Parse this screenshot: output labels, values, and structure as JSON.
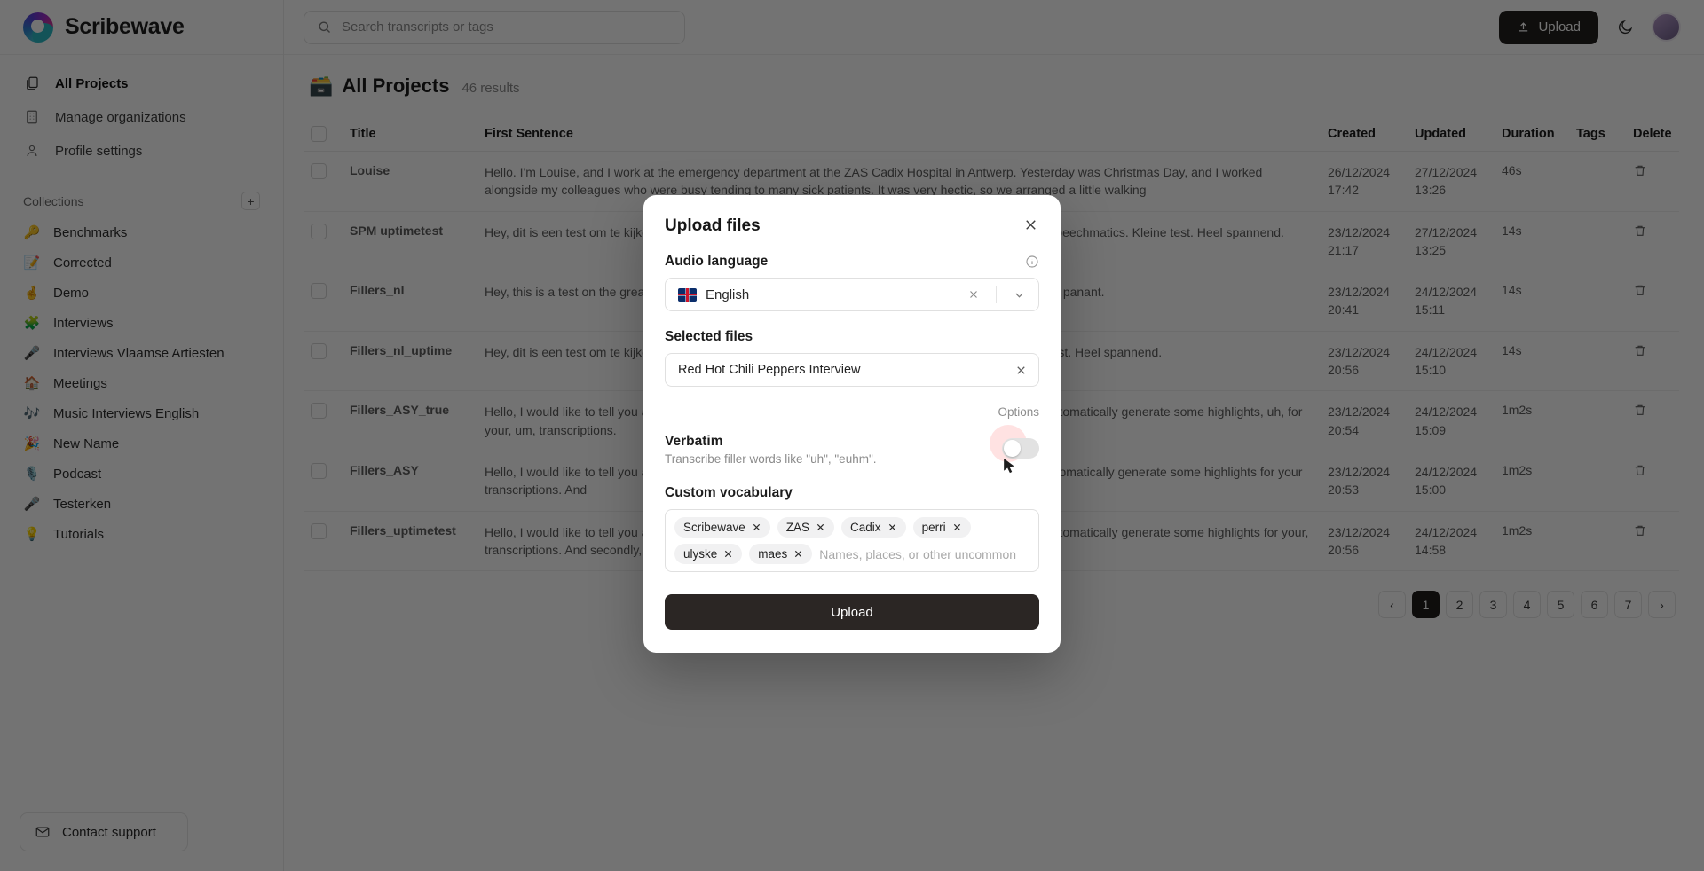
{
  "sidebar": {
    "brand": "Scribewave",
    "nav": [
      {
        "label": "All Projects",
        "icon": "documents-icon"
      },
      {
        "label": "Manage organizations",
        "icon": "building-icon"
      },
      {
        "label": "Profile settings",
        "icon": "user-icon"
      }
    ],
    "collections_title": "Collections",
    "add_label": "+",
    "collections": [
      {
        "emoji": "🔑",
        "label": "Benchmarks"
      },
      {
        "emoji": "📝",
        "label": "Corrected"
      },
      {
        "emoji": "🤞",
        "label": "Demo"
      },
      {
        "emoji": "🧩",
        "label": "Interviews"
      },
      {
        "emoji": "🎤",
        "label": "Interviews Vlaamse Artiesten"
      },
      {
        "emoji": "🏠",
        "label": "Meetings"
      },
      {
        "emoji": "🎶",
        "label": "Music Interviews English"
      },
      {
        "emoji": "🎉",
        "label": "New Name"
      },
      {
        "emoji": "🎙️",
        "label": "Podcast"
      },
      {
        "emoji": "🎤",
        "label": "Testerken"
      },
      {
        "emoji": "💡",
        "label": "Tutorials"
      }
    ],
    "support_label": "Contact support"
  },
  "topbar": {
    "search_placeholder": "Search transcripts or tags",
    "upload_label": "Upload",
    "theme_icon": "moon-icon"
  },
  "page": {
    "title": "All Projects",
    "title_emoji": "🗃️",
    "results": "46 results"
  },
  "table": {
    "columns": [
      "Title",
      "First Sentence",
      "Created",
      "Updated",
      "Duration",
      "Tags",
      "Delete"
    ],
    "rows": [
      {
        "title": "Louise",
        "sentence": "Hello. I'm Louise, and I work at the emergency department at the ZAS Cadix Hospital in Antwerp. Yesterday was Christmas Day, and I worked alongside my colleagues who were busy tending to many sick patients. It was very hectic, so we arranged a little walking",
        "created_date": "26/12/2024",
        "created_time": "17:42",
        "updated_date": "27/12/2024",
        "updated_time": "13:26",
        "duration": "46s"
      },
      {
        "title": "SPM uptimetest",
        "sentence": "Hey, dit is een test om te kijken of onze uptime goed is en of alles correct getranscribeerd worden met Speechmatics. Kleine test. Heel spannend.",
        "created_date": "23/12/2024",
        "created_time": "21:17",
        "updated_date": "27/12/2024",
        "updated_time": "13:25",
        "duration": "14s"
      },
      {
        "title": "Fillers_nl",
        "sentence": "Hey, this is a test on the great platform of Scribewave to see what were the speechmatics clementist hills panant.",
        "created_date": "23/12/2024",
        "created_time": "20:41",
        "updated_date": "24/12/2024",
        "updated_time": "15:11",
        "duration": "14s"
      },
      {
        "title": "Fillers_nl_uptime",
        "sentence": "Hey, dit is een test om te kijken of alles correct getranscribeerd worden met Speechmatics! Een kleine test. Heel spannend.",
        "created_date": "23/12/2024",
        "created_time": "20:56",
        "updated_date": "24/12/2024",
        "updated_time": "15:10",
        "duration": "14s"
      },
      {
        "title": "Fillers_ASY_true",
        "sentence": "Hello, I would like to tell you about Scribewave, which is a very nice, tool which allows you to highlight automatically generate some highlights, uh, for your, um, transcriptions.",
        "created_date": "23/12/2024",
        "created_time": "20:54",
        "updated_date": "24/12/2024",
        "updated_time": "15:09",
        "duration": "1m2s"
      },
      {
        "title": "Fillers_ASY",
        "sentence": "Hello, I would like to tell you about Scribewave, which is a very nice tool which allows you to highlight automatically generate some highlights for your transcriptions. And",
        "created_date": "23/12/2024",
        "created_time": "20:53",
        "updated_date": "24/12/2024",
        "updated_time": "15:00",
        "duration": "1m2s"
      },
      {
        "title": "Fillers_uptimetest",
        "sentence": "Hello, I would like to tell you about Scribewave, which is a very nice, tool which allows you to highlight automatically generate some highlights for your, transcriptions. And secondly, the",
        "created_date": "23/12/2024",
        "created_time": "20:56",
        "updated_date": "24/12/2024",
        "updated_time": "14:58",
        "duration": "1m2s"
      }
    ]
  },
  "pagination": {
    "prev": "‹",
    "next": "›",
    "pages": [
      "1",
      "2",
      "3",
      "4",
      "5",
      "6",
      "7"
    ],
    "active": "1"
  },
  "modal": {
    "title": "Upload files",
    "close_icon": "close-icon",
    "language_label": "Audio language",
    "info_icon": "info-icon",
    "language_value": "English",
    "language_flag": "uk-flag-icon",
    "selected_files_label": "Selected files",
    "file_name": "Red Hot Chili Peppers Interview",
    "options_divider": "Options",
    "verbatim_label": "Verbatim",
    "verbatim_sub": "Transcribe filler words like \"uh\", \"euhm\".",
    "verbatim_on": false,
    "vocab_label": "Custom vocabulary",
    "vocab_chips": [
      "Scribewave",
      "ZAS",
      "Cadix",
      "perri",
      "ulyske",
      "maes"
    ],
    "vocab_placeholder": "Names, places, or other uncommon",
    "upload_label": "Upload"
  },
  "colors": {
    "accent_dark": "#231f1e",
    "modal_button": "#2b2624",
    "overlay": "rgba(0,0,0,.55)"
  }
}
